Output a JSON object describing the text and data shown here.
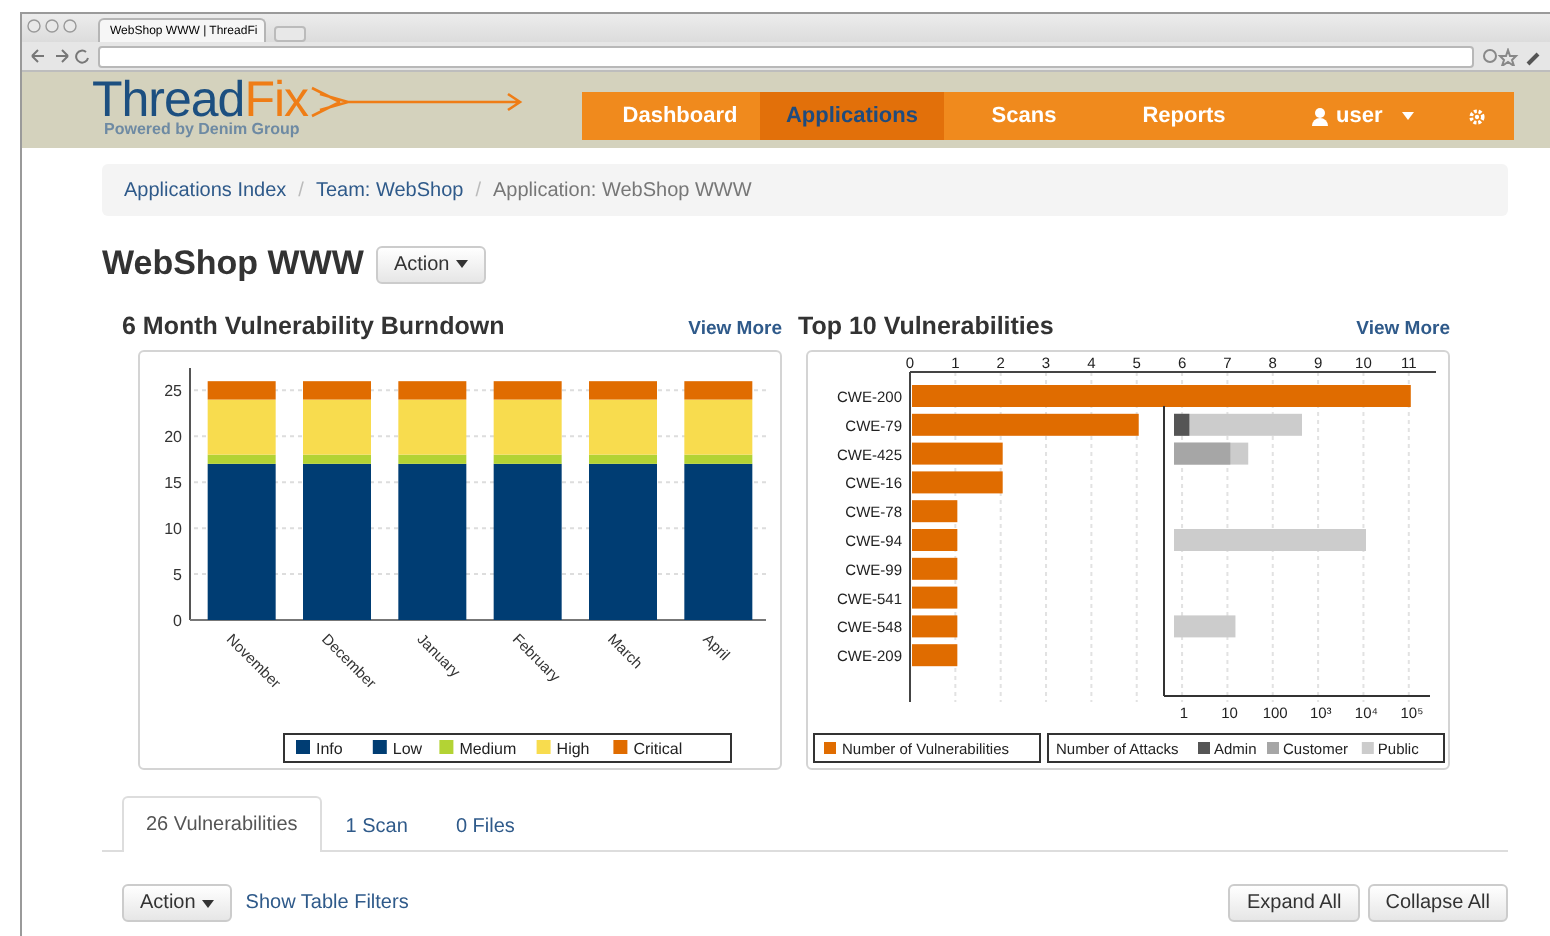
{
  "browser": {
    "tab_title": "WebShop WWW | ThreadFi"
  },
  "logo": {
    "parts": [
      "Thread",
      "Fix"
    ],
    "tagline": "Powered by Denim Group"
  },
  "nav": {
    "items": [
      {
        "label": "Dashboard",
        "selected": false
      },
      {
        "label": "Applications",
        "selected": true
      },
      {
        "label": "Scans",
        "selected": false
      },
      {
        "label": "Reports",
        "selected": false
      }
    ],
    "user": "user"
  },
  "breadcrumb": {
    "items": [
      {
        "label": "Applications Index",
        "kind": "link",
        "separator": "/"
      },
      {
        "label": "Team: WebShop",
        "kind": "link",
        "separator": "/"
      },
      {
        "label": "Application: WebShop WWW",
        "kind": "current"
      }
    ]
  },
  "page_title": "WebShop WWW",
  "action_button": "Action",
  "burndown": {
    "title": "6 Month Vulnerability Burndown",
    "view_more": "View More",
    "chart_data": {
      "type": "bar",
      "stacked": true,
      "grid": true,
      "legend": true,
      "categories": [
        "November",
        "December",
        "January",
        "February",
        "March",
        "April"
      ],
      "yticks": [
        0,
        5,
        10,
        15,
        20,
        25
      ],
      "ylim": [
        0,
        27
      ],
      "series": [
        {
          "name": "Info",
          "color": "#003d73",
          "values": [
            0,
            0,
            0,
            0,
            0,
            0
          ]
        },
        {
          "name": "Low",
          "color": "#003d73",
          "values": [
            17,
            17,
            17,
            17,
            17,
            17
          ]
        },
        {
          "name": "Medium",
          "color": "#b3d334",
          "values": [
            1,
            1,
            1,
            1,
            1,
            1
          ]
        },
        {
          "name": "High",
          "color": "#f8dc4e",
          "values": [
            6,
            6,
            6,
            6,
            6,
            6
          ]
        },
        {
          "name": "Critical",
          "color": "#e06c00",
          "values": [
            2,
            2,
            2,
            2,
            2,
            2
          ]
        }
      ]
    }
  },
  "top10": {
    "title": "Top 10 Vulnerabilities",
    "view_more": "View More",
    "chart_data": {
      "type": "bar",
      "orientation": "horizontal",
      "grid": true,
      "legend": true,
      "categories": [
        "CWE-200",
        "CWE-79",
        "CWE-425",
        "CWE-16",
        "CWE-78",
        "CWE-94",
        "CWE-99",
        "CWE-541",
        "CWE-548",
        "CWE-209"
      ],
      "xticks": [
        0,
        1,
        2,
        3,
        4,
        5,
        6,
        7,
        8,
        9,
        10,
        11
      ],
      "xlim": [
        0,
        11.6
      ],
      "series": [
        {
          "name": "Number of Vulnerabilities",
          "color": "#e06c00",
          "values": [
            11,
            5,
            2,
            2,
            1,
            1,
            1,
            1,
            1,
            1
          ]
        }
      ]
    },
    "attacks": {
      "legend_title": "Number of Attacks",
      "axis_labels": [
        "1",
        "10",
        "100",
        "10³",
        "10⁴",
        "10⁵"
      ],
      "legend": [
        {
          "name": "Admin",
          "color": "#555555"
        },
        {
          "name": "Customer",
          "color": "#a6a6a6"
        },
        {
          "name": "Public",
          "color": "#cccccc"
        }
      ],
      "rows": [
        {},
        {
          "bars": [
            {
              "kind": "public",
              "level": 0.5
            },
            {
              "kind": "admin",
              "level": 0.06
            }
          ]
        },
        {
          "bars": [
            {
              "kind": "public",
              "level": 0.29
            },
            {
              "kind": "customer",
              "level": 0.22
            }
          ]
        },
        {},
        {},
        {
          "bars": [
            {
              "kind": "public",
              "level": 0.75
            }
          ]
        },
        {},
        {},
        {
          "bars": [
            {
              "kind": "public",
              "level": 0.24
            }
          ]
        },
        {}
      ]
    }
  },
  "tabs": [
    {
      "label": "26 Vulnerabilities",
      "selected": true
    },
    {
      "label": "1 Scan",
      "selected": false
    },
    {
      "label": "0 Files",
      "selected": false
    }
  ],
  "table_toolbar": {
    "action": "Action",
    "filters_link": "Show Table Filters",
    "buttons": [
      "Expand All",
      "Collapse All"
    ]
  }
}
